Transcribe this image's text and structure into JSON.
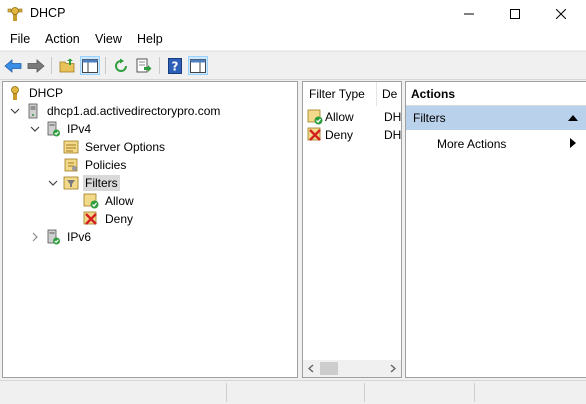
{
  "window": {
    "title": "DHCP",
    "icon": "dhcp-server-icon",
    "controls": [
      "minimize-icon",
      "maximize-icon",
      "close-icon"
    ]
  },
  "menu": {
    "items": [
      "File",
      "Action",
      "View",
      "Help"
    ]
  },
  "toolbar": {
    "buttons": [
      "back-arrow-icon",
      "forward-arrow-icon",
      "up-folder-icon",
      "show-hide-console-tree-icon",
      "refresh-icon",
      "export-list-icon",
      "help-icon",
      "show-hide-action-pane-icon"
    ]
  },
  "tree": {
    "root": "DHCP",
    "server": "dhcp1.ad.activedirectorypro.com",
    "ipv4": "IPv4",
    "server_options": "Server Options",
    "policies": "Policies",
    "filters": "Filters",
    "allow": "Allow",
    "deny": "Deny",
    "ipv6": "IPv6"
  },
  "list": {
    "columns": [
      "Filter Type",
      "De"
    ],
    "rows": [
      {
        "type": "Allow",
        "desc": "DH"
      },
      {
        "type": "Deny",
        "desc": "DH"
      }
    ]
  },
  "actions": {
    "title": "Actions",
    "group": "Filters",
    "items": [
      "More Actions"
    ]
  },
  "colors": {
    "selection_gray": "#d9d9d9",
    "actions_header_blue": "#b9d1ea",
    "toolbar_pressed": "#cde8ff"
  }
}
